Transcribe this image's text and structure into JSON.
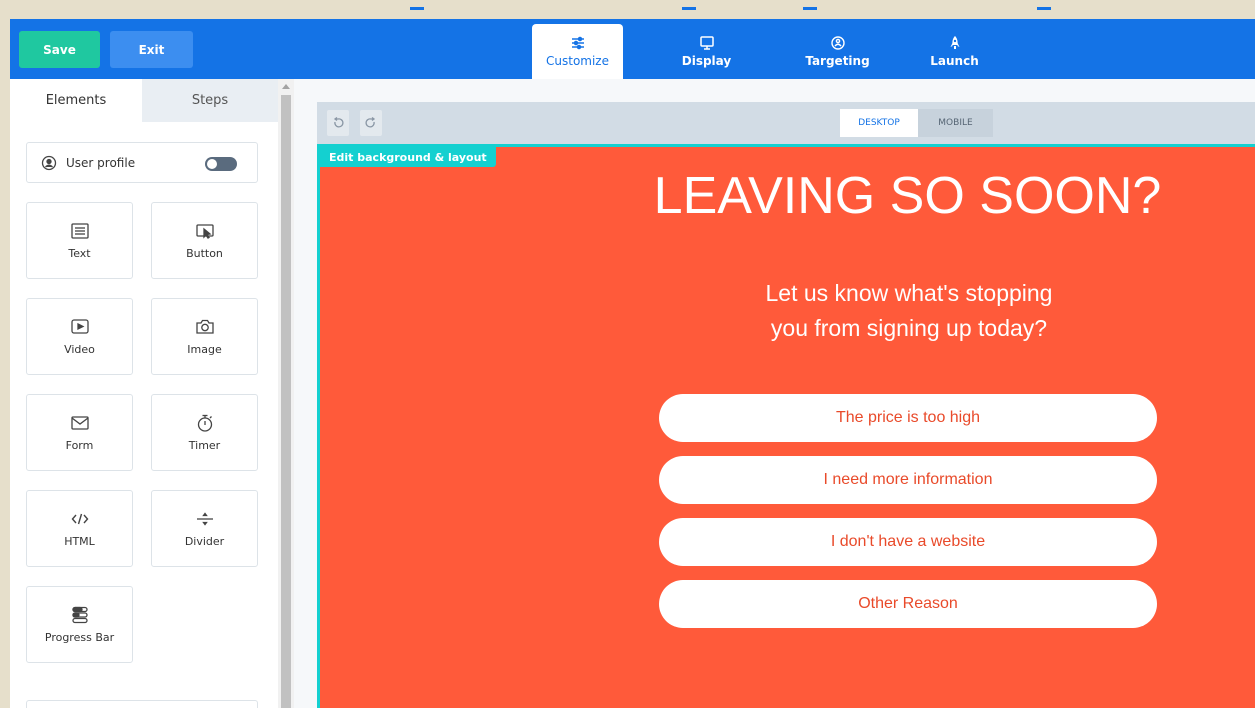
{
  "toolbar": {
    "save_label": "Save",
    "exit_label": "Exit"
  },
  "nav": {
    "tabs": [
      {
        "label": "Customize",
        "icon": "sliders-icon",
        "active": true
      },
      {
        "label": "Display",
        "icon": "monitor-icon",
        "active": false
      },
      {
        "label": "Targeting",
        "icon": "target-icon",
        "active": false
      },
      {
        "label": "Launch",
        "icon": "rocket-icon",
        "active": false
      }
    ]
  },
  "sidebar": {
    "tabs": [
      {
        "label": "Elements",
        "active": true
      },
      {
        "label": "Steps",
        "active": false
      }
    ],
    "user_profile": {
      "label": "User profile",
      "toggle_on": false
    },
    "elements": [
      {
        "label": "Text",
        "icon": "text-icon"
      },
      {
        "label": "Button",
        "icon": "button-icon"
      },
      {
        "label": "Video",
        "icon": "video-icon"
      },
      {
        "label": "Image",
        "icon": "camera-icon"
      },
      {
        "label": "Form",
        "icon": "envelope-icon"
      },
      {
        "label": "Timer",
        "icon": "stopwatch-icon"
      },
      {
        "label": "HTML",
        "icon": "code-icon"
      },
      {
        "label": "Divider",
        "icon": "divider-icon"
      },
      {
        "label": "Progress Bar",
        "icon": "progress-bar-icon"
      }
    ]
  },
  "canvas": {
    "view_modes": [
      {
        "label": "DESKTOP",
        "active": true
      },
      {
        "label": "MOBILE",
        "active": false
      }
    ],
    "edit_background_label": "Edit background & layout"
  },
  "popup": {
    "headline": "LEAVING SO SOON?",
    "subtext_line1": "Let us know what's stopping",
    "subtext_line2": "you from signing up today?",
    "answers": [
      "The price is too high",
      "I need more information",
      "I don't have a website",
      "Other Reason"
    ]
  },
  "colors": {
    "topbar": "#1473e6",
    "save_button": "#1fc8a0",
    "exit_button": "#3c8ef0",
    "popup_background": "#ff5a3a",
    "highlight": "#14d0d0",
    "answer_text": "#e94a2a"
  }
}
